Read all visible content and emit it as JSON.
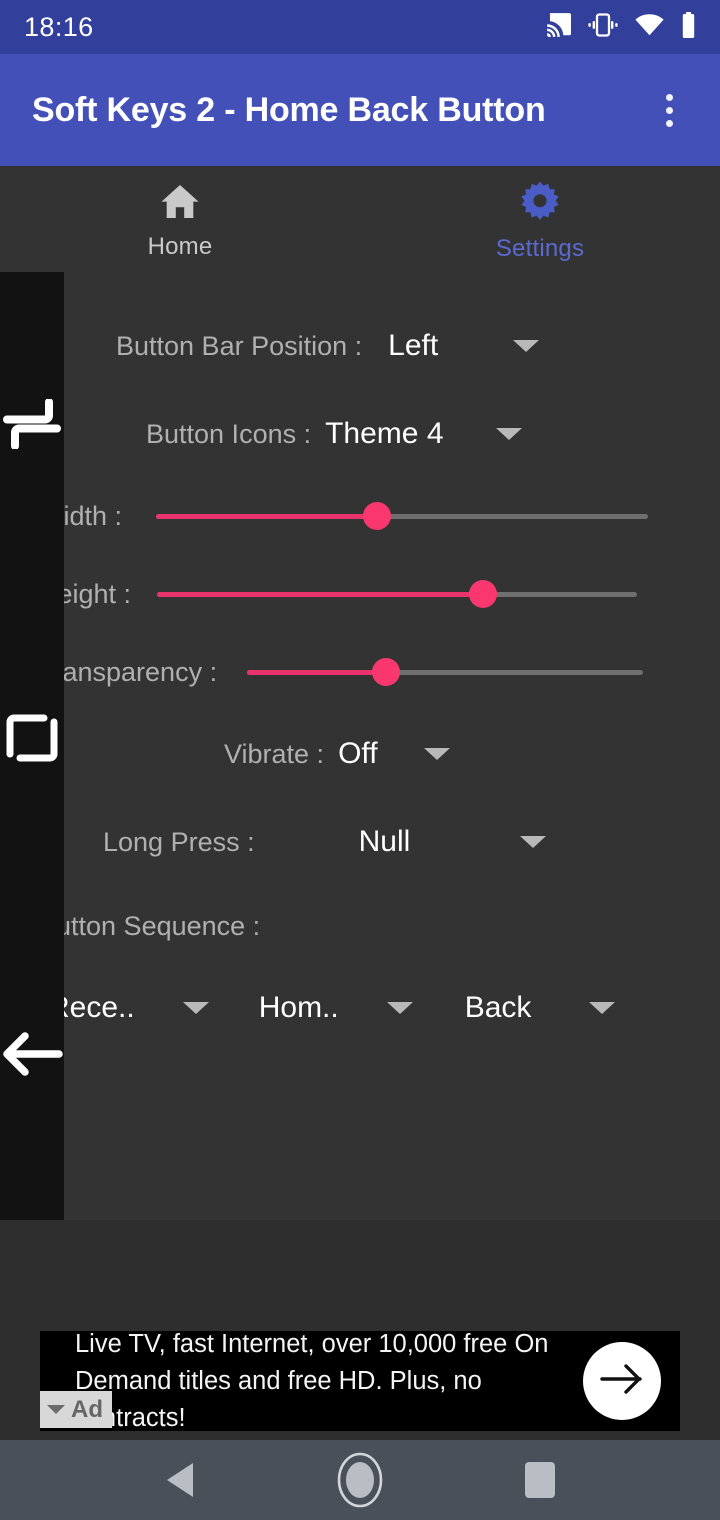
{
  "status_bar": {
    "time": "18:16",
    "icons": [
      "cast-icon",
      "vibrate-icon",
      "wifi-icon",
      "battery-icon"
    ]
  },
  "app_bar": {
    "title": "Soft Keys 2 - Home Back Button",
    "overflow_icon": "more-vert-icon",
    "background": "#4350b8"
  },
  "tabs": [
    {
      "label": "Home",
      "icon": "home-icon",
      "active": false
    },
    {
      "label": "Settings",
      "icon": "gear-icon",
      "active": true
    }
  ],
  "settings": {
    "button_bar_position": {
      "label": "Button Bar Position :",
      "value": "Left"
    },
    "button_icons": {
      "label": "Button Icons :",
      "value": "Theme 4"
    },
    "width": {
      "label": "Width :",
      "percent": 45
    },
    "height": {
      "label": "Height :",
      "percent": 68
    },
    "transparency": {
      "label": "Transparency :",
      "percent": 35
    },
    "vibrate": {
      "label": "Vibrate :",
      "value": "Off"
    },
    "long_press": {
      "label": "Long Press :",
      "value": "Null"
    },
    "button_sequence": {
      "label": "Button Sequence :",
      "slots": [
        {
          "value": "Rece.."
        },
        {
          "value": "Hom.."
        },
        {
          "value": "Back"
        }
      ]
    }
  },
  "overlay_bar": {
    "position": "left",
    "background": "#121212",
    "keys": [
      {
        "name": "recents-key",
        "icon": "recents-icon"
      },
      {
        "name": "home-key",
        "icon": "home-square-icon"
      },
      {
        "name": "back-key",
        "icon": "back-arrow-icon"
      }
    ]
  },
  "ad": {
    "text": "Live TV, fast Internet, over 10,000 free On Demand titles and free HD. Plus, no contracts!",
    "badge_label": "Ad",
    "cta_icon": "arrow-right-icon"
  },
  "nav_bar": {
    "buttons": [
      "back-nav-button",
      "home-nav-button",
      "recents-nav-button"
    ]
  },
  "colors": {
    "accent": "#fa376f",
    "app_bar": "#4350b8",
    "status_bar": "#33409b",
    "content_bg": "#333333",
    "nav_bg": "#495059"
  }
}
